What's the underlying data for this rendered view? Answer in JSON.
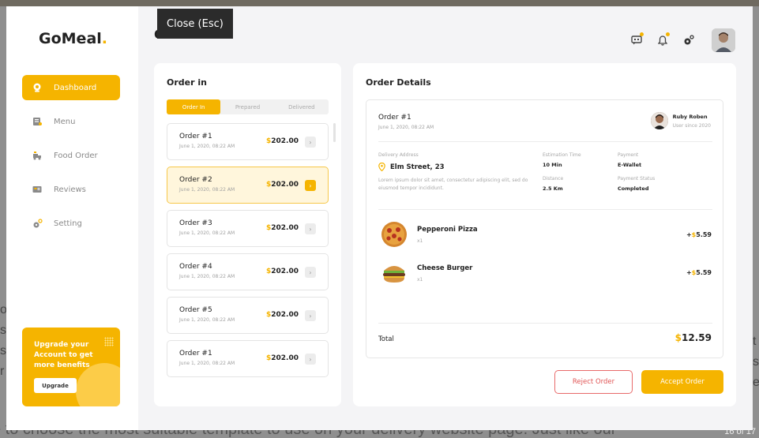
{
  "background": {
    "text": "e to choose the most suitable template to use on your delivery website page. Just like our",
    "counter": "16 of 17",
    "left_edge": "o\ns\ns\nr",
    "right_edge": "t\ns\ne"
  },
  "tooltip": {
    "label": "Close (Esc)"
  },
  "brand": {
    "name": "GoMeal",
    "dot": "."
  },
  "page_title": "O",
  "sidebar": {
    "items": [
      {
        "label": "Dashboard",
        "icon": "dashboard-icon",
        "active": true
      },
      {
        "label": "Menu",
        "icon": "menu-icon"
      },
      {
        "label": "Food Order",
        "icon": "food-order-icon"
      },
      {
        "label": "Reviews",
        "icon": "reviews-icon"
      },
      {
        "label": "Setting",
        "icon": "settings-icon"
      }
    ]
  },
  "upgrade": {
    "text": "Upgrade your Account to get more benefits",
    "button": "Upgrade"
  },
  "order_in": {
    "title": "Order in",
    "tabs": [
      "Order In",
      "Prepared",
      "Delivered"
    ],
    "orders": [
      {
        "name": "Order #1",
        "date": "June 1, 2020, 08:22 AM",
        "currency": "$",
        "amount": "202.00",
        "selected": false
      },
      {
        "name": "Order #2",
        "date": "June 1, 2020, 08:22 AM",
        "currency": "$",
        "amount": "202.00",
        "selected": true
      },
      {
        "name": "Order #3",
        "date": "June 1, 2020, 08:22 AM",
        "currency": "$",
        "amount": "202.00",
        "selected": false
      },
      {
        "name": "Order #4",
        "date": "June 1, 2020, 08:22 AM",
        "currency": "$",
        "amount": "202.00",
        "selected": false
      },
      {
        "name": "Order #5",
        "date": "June 1, 2020, 08:22 AM",
        "currency": "$",
        "amount": "202.00",
        "selected": false
      },
      {
        "name": "Order #1",
        "date": "June 1, 2020, 08:22 AM",
        "currency": "$",
        "amount": "202.00",
        "selected": false
      }
    ]
  },
  "details": {
    "title": "Order Details",
    "order": "Order #1",
    "date": "June 1, 2020, 08:22 AM",
    "customer": {
      "name": "Ruby Roben",
      "since": "User since 2020"
    },
    "address_label": "Delivery Address",
    "address": "Elm Street, 23",
    "address_desc": "Lorem ipsum dolor sit amet, consectetur adipiscing elit, sed do eiusmod tempor incididunt.",
    "estimation_label": "Estimation Time",
    "estimation": "10 Min",
    "payment_label": "Payment",
    "payment": "E-Wallet",
    "distance_label": "Distance",
    "distance": "2.5 Km",
    "status_label": "Payment Status",
    "status": "Completed",
    "items": [
      {
        "name": "Pepperoni Pizza",
        "qty": "x1",
        "sign": "+",
        "currency": "$",
        "price": "5.59"
      },
      {
        "name": "Cheese Burger",
        "qty": "x1",
        "sign": "+",
        "currency": "$",
        "price": "5.59"
      }
    ],
    "total_label": "Total",
    "total_currency": "$",
    "total": "12.59",
    "reject_label": "Reject Order",
    "accept_label": "Accept Order"
  },
  "colors": {
    "accent": "#f5b400",
    "reject": "#e05555"
  }
}
